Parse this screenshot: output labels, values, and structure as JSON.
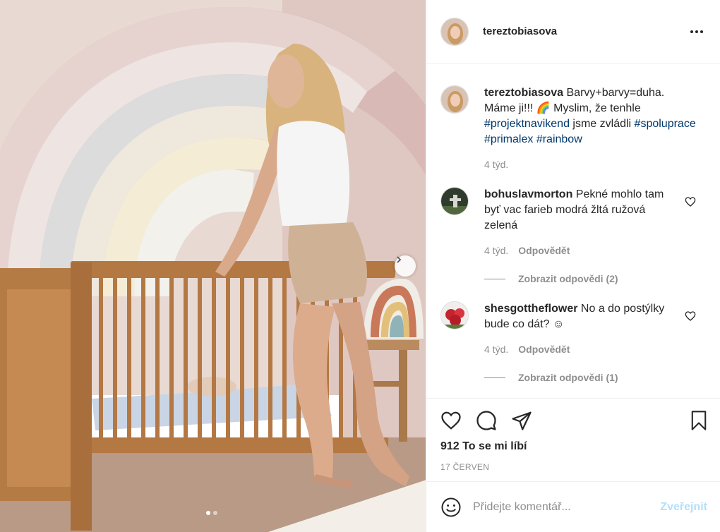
{
  "post": {
    "author": "tereztobiasova",
    "caption": {
      "username": "tereztobiasova",
      "text_before": " Barvy+barvy=duha. Máme ji!!! 🌈 Myslim, že tenhle ",
      "hashtag1": "#projektnavikend",
      "text_middle": " jsme zvládli ",
      "hashtag2": "#spoluprace",
      "hashtag3": "#primalex",
      "hashtag4": "#rainbow",
      "time": "4 týd."
    },
    "comments": [
      {
        "username": "bohuslavmorton",
        "text": " Pekné mohlo tam byť vac farieb modrá žltá ružová zelená",
        "time": "4 týd.",
        "reply_label": "Odpovědět",
        "view_replies": "Zobrazit odpovědi (2)"
      },
      {
        "username": "shesgottheflower",
        "text": " No a do postýlky bude co dát? ☺",
        "time": "4 týd.",
        "reply_label": "Odpovědět",
        "view_replies": "Zobrazit odpovědi (1)"
      }
    ],
    "likes": "912 To se mi líbí",
    "date": "17 ČERVEN",
    "add_comment_placeholder": "Přidejte komentář...",
    "post_button": "Zveřejnit",
    "carousel": {
      "current": 1,
      "total": 2
    }
  },
  "colors": {
    "link": "#00376b",
    "muted": "#8e8e8e",
    "post_disabled": "#b2dffc"
  }
}
